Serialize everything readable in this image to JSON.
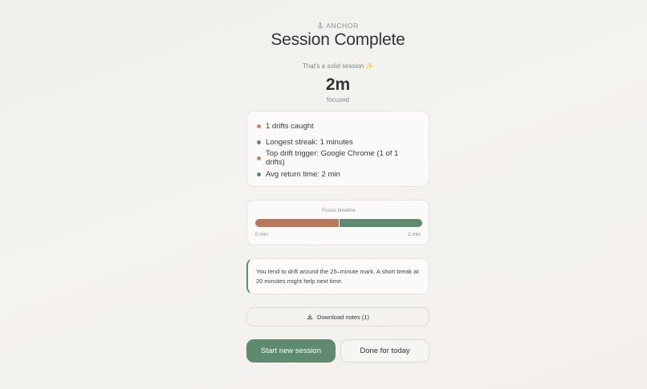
{
  "brand": {
    "name": "ANCHOR",
    "icon": "anchor-icon"
  },
  "title": "Session Complete",
  "subtitle": "That's a solid session",
  "subtitle_emoji": "✨",
  "metric": {
    "value": "2m",
    "label": "focused"
  },
  "stats": [
    {
      "text": "1 drifts caught",
      "color": "#b98a6a"
    },
    {
      "text": "Longest streak: 1 minutes",
      "color": "#5e8a6f"
    },
    {
      "text": "Top drift trigger: Google Chrome (1 of 1 drifts)",
      "color": "#b98a6a"
    },
    {
      "text": "Avg return time: 2 min",
      "color": "#5e8a6f"
    }
  ],
  "timeline": {
    "label": "Focus timeline",
    "start_label": "0 min",
    "end_label": "2 min",
    "segments": [
      {
        "type": "drift",
        "fraction": 0.5,
        "color": "#b9775c"
      },
      {
        "type": "focus",
        "fraction": 0.5,
        "color": "#5e8a6f"
      }
    ]
  },
  "insight": "You tend to drift around the 25–minute mark. A short break at 20 minutes might help next time.",
  "download_label": "Download notes (1)",
  "buttons": {
    "primary": "Start new session",
    "secondary": "Done for today"
  },
  "colors": {
    "accent": "#5e8a6f",
    "drift": "#b9775c"
  }
}
